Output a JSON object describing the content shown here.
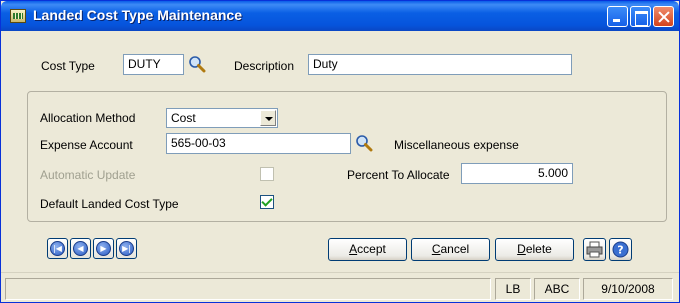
{
  "window": {
    "title": "Landed Cost Type Maintenance"
  },
  "header": {
    "cost_type_label": "Cost Type",
    "cost_type_value": "DUTY",
    "description_label": "Description",
    "description_value": "Duty"
  },
  "group": {
    "allocation_method_label": "Allocation Method",
    "allocation_method_value": "Cost",
    "expense_account_label": "Expense Account",
    "expense_account_value": "565-00-03",
    "expense_account_desc": "Miscellaneous expense",
    "automatic_update_label": "Automatic Update",
    "automatic_update_checked": false,
    "percent_label": "Percent To Allocate",
    "percent_value": "5.000",
    "default_label": "Default Landed Cost Type",
    "default_checked": true
  },
  "buttons": {
    "accept": {
      "ul": "A",
      "rest": "ccept"
    },
    "cancel": {
      "ul": "C",
      "rest": "ancel"
    },
    "delete": {
      "ul": "D",
      "rest": "elete"
    }
  },
  "nav_icons": [
    "first-record-icon",
    "previous-record-icon",
    "next-record-icon",
    "last-record-icon"
  ],
  "status": {
    "user": "LB",
    "company": "ABC",
    "date": "9/10/2008"
  },
  "colors": {
    "titlebar": "#0a5ce8",
    "window_bg": "#ece9d8",
    "field_border": "#7f9db9",
    "button_border": "#003c74"
  }
}
